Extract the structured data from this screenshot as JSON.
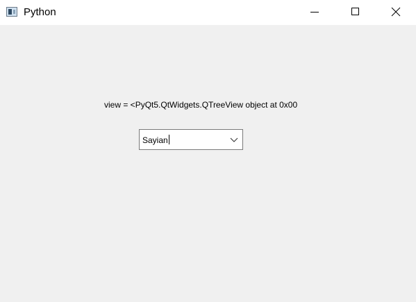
{
  "window": {
    "title": "Python",
    "icon": "python-app-icon",
    "controls": [
      "minimize-icon",
      "maximize-icon",
      "close-icon"
    ]
  },
  "content": {
    "view_label": "view = <PyQt5.QtWidgets.QTreeView object at 0x00",
    "combo": {
      "value": "Sayian",
      "icon": "chevron-down-icon"
    }
  },
  "colors": {
    "titlebar": "#ffffff",
    "client_bg": "#f0f0f0",
    "combo_border": "#7a7a7a"
  }
}
